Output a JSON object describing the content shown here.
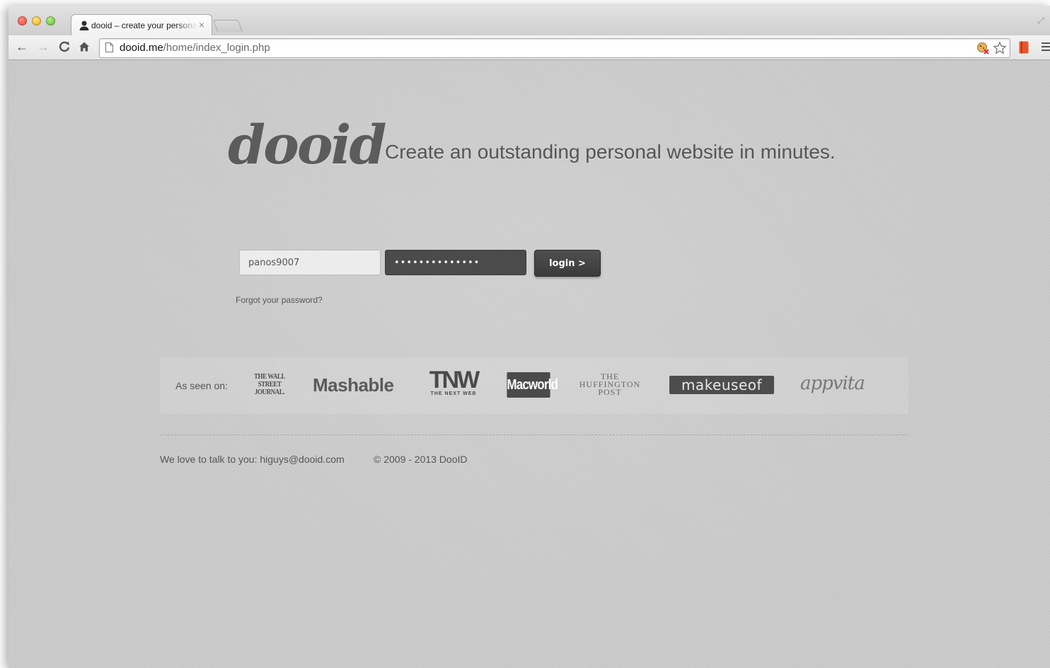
{
  "browser": {
    "tab": {
      "title": "dooid – create your personal website",
      "close_glyph": "×",
      "favicon": "person-icon"
    },
    "toolbar": {
      "back_glyph": "←",
      "forward_glyph": "→",
      "reload_glyph": "C",
      "home_glyph": "⌂",
      "url_host": "dooid.me",
      "url_path": "/home/index_login.php"
    },
    "icons": [
      "back-icon",
      "forward-icon",
      "reload-icon",
      "home-icon",
      "page-icon",
      "extension-icon",
      "bookmark-star-icon",
      "bookmark-extension-icon",
      "menu-icon"
    ]
  },
  "page": {
    "logo": "dooid",
    "tagline": "Create an outstanding personal website in minutes.",
    "login": {
      "username_value": "panos9007",
      "password_value": "••••••••••••••",
      "button_label": "login >",
      "forgot_label": "Forgot your password?"
    },
    "press": {
      "label": "As seen on:",
      "wsj": "THE WALL STREET JOURNAL.",
      "mashable": "Mashable",
      "tnw_big": "TNW",
      "tnw_small": "THE NEXT WEB",
      "macworld": "Macworld",
      "huffpo": "THE HUFFINGTON POST",
      "makeuseof": "makeuseof",
      "appvita": "appvita"
    },
    "footer": {
      "contact": "We love to talk to you: higuys@dooid.com",
      "copyright": "© 2009 - 2013 DooID"
    }
  },
  "colors": {
    "background": "#cbcbcb",
    "logo": "#5c5c5c",
    "button": "#3b3b3b",
    "password_field": "#4b4b4b"
  }
}
